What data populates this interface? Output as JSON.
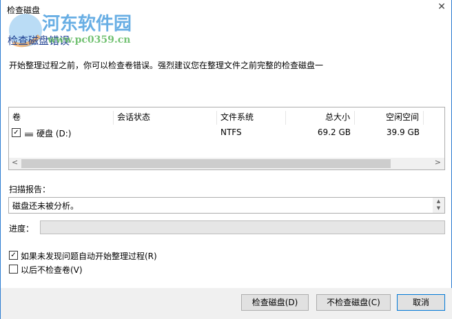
{
  "window": {
    "title": "检查磁盘",
    "close": "✕"
  },
  "watermark": {
    "name": "河东软件园",
    "url": "www.pc0359.cn"
  },
  "heading": "检查磁盘错误",
  "description": "开始整理过程之前，你可以检查卷错误。强烈建议您在整理文件之前完整的检查磁盘一",
  "table": {
    "columns": [
      "卷",
      "会话状态",
      "文件系统",
      "总大小",
      "空闲空间"
    ],
    "rows": [
      {
        "checked": true,
        "volume": "硬盘 (D:)",
        "status": "",
        "fs": "NTFS",
        "total": "69.2 GB",
        "free": "39.9 GB"
      }
    ]
  },
  "scan": {
    "label": "扫描报告：",
    "text": "磁盘还未被分析。"
  },
  "progress": {
    "label": "进度：",
    "value": 0
  },
  "options": [
    {
      "label": "如果未发现问题自动开始整理过程(R)",
      "checked": true
    },
    {
      "label": "以后不检查卷(V)",
      "checked": false
    }
  ],
  "buttons": {
    "check": "检查磁盘(D)",
    "nocheck": "不检查磁盘(C)",
    "cancel": "取消"
  }
}
